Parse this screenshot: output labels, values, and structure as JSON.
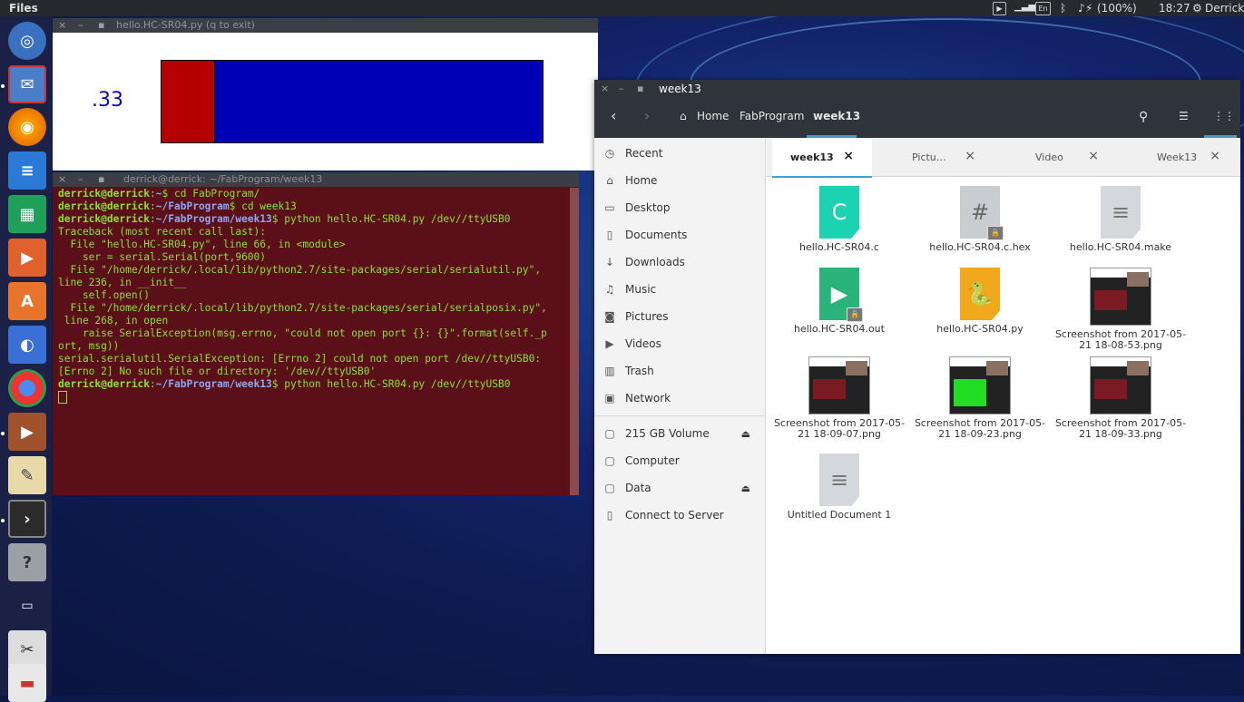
{
  "top_panel": {
    "app_name": "Files",
    "keyboard": "En",
    "battery": "(100%)",
    "time": "18:27",
    "user": "Derrick"
  },
  "wave_window": {
    "title": "hello.HC-SR04.py (q to exit)",
    "value": ".33",
    "fraction": 0.14
  },
  "terminal": {
    "title": "derrick@derrick: ~/FabProgram/week13",
    "lines": [
      {
        "user": "derrick@derrick",
        "path": "~",
        "cmd": "$ cd FabProgram/"
      },
      {
        "user": "derrick@derrick",
        "path": "~/FabProgram",
        "cmd": "$ cd week13"
      },
      {
        "user": "derrick@derrick",
        "path": "~/FabProgram/week13",
        "cmd": "$ python hello.HC-SR04.py /dev//ttyUSB0"
      },
      {
        "text": "Traceback (most recent call last):"
      },
      {
        "text": "  File \"hello.HC-SR04.py\", line 66, in <module>"
      },
      {
        "text": "    ser = serial.Serial(port,9600)"
      },
      {
        "text": "  File \"/home/derrick/.local/lib/python2.7/site-packages/serial/serialutil.py\","
      },
      {
        "text": "line 236, in __init__"
      },
      {
        "text": "    self.open()"
      },
      {
        "text": "  File \"/home/derrick/.local/lib/python2.7/site-packages/serial/serialposix.py\","
      },
      {
        "text": " line 268, in open"
      },
      {
        "text": "    raise SerialException(msg.errno, \"could not open port {}: {}\".format(self._p"
      },
      {
        "text": "ort, msg))"
      },
      {
        "text": "serial.serialutil.SerialException: [Errno 2] could not open port /dev//ttyUSB0:"
      },
      {
        "text": "[Errno 2] No such file or directory: '/dev//ttyUSB0'"
      },
      {
        "user": "derrick@derrick",
        "path": "~/FabProgram/week13",
        "cmd": "$ python hello.HC-SR04.py /dev//ttyUSB0"
      }
    ]
  },
  "files": {
    "title": "week13",
    "breadcrumb": [
      "Home",
      "FabProgram",
      "week13"
    ],
    "sidebar": [
      {
        "label": "Recent",
        "icon": "clock-icon"
      },
      {
        "label": "Home",
        "icon": "home-icon"
      },
      {
        "label": "Desktop",
        "icon": "folder-icon"
      },
      {
        "label": "Documents",
        "icon": "document-icon"
      },
      {
        "label": "Downloads",
        "icon": "download-icon"
      },
      {
        "label": "Music",
        "icon": "music-icon"
      },
      {
        "label": "Pictures",
        "icon": "camera-icon"
      },
      {
        "label": "Videos",
        "icon": "video-icon"
      },
      {
        "label": "Trash",
        "icon": "trash-icon"
      },
      {
        "label": "Network",
        "icon": "network-icon"
      },
      {
        "label": "215 GB Volume",
        "icon": "drive-icon",
        "eject": true
      },
      {
        "label": "Computer",
        "icon": "drive-icon"
      },
      {
        "label": "Data",
        "icon": "drive-icon",
        "eject": true
      },
      {
        "label": "Connect to Server",
        "icon": "server-icon"
      }
    ],
    "tabs": [
      {
        "label": "week13",
        "active": true
      },
      {
        "label": "Pictu…"
      },
      {
        "label": "Video"
      },
      {
        "label": "Week13"
      }
    ],
    "items": [
      {
        "name": "hello.HC-SR04.c",
        "kind": "c"
      },
      {
        "name": "hello.HC-SR04.c.hex",
        "kind": "hex"
      },
      {
        "name": "hello.HC-SR04.make",
        "kind": "text"
      },
      {
        "name": "hello.HC-SR04.out",
        "kind": "exec"
      },
      {
        "name": "hello.HC-SR04.py",
        "kind": "python"
      },
      {
        "name": "Screenshot from 2017-05-21 18-08-53.png",
        "kind": "shot"
      },
      {
        "name": "Screenshot from 2017-05-21 18-09-07.png",
        "kind": "shot"
      },
      {
        "name": "Screenshot from 2017-05-21 18-09-23.png",
        "kind": "shot-green"
      },
      {
        "name": "Screenshot from 2017-05-21 18-09-33.png",
        "kind": "shot"
      },
      {
        "name": "Untitled Document 1",
        "kind": "text"
      }
    ]
  }
}
